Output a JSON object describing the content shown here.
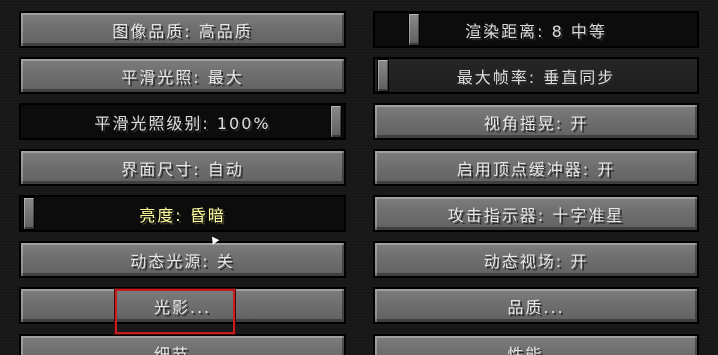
{
  "left": {
    "graphics": "图像品质: 高品质",
    "smooth_lighting": "平滑光照: 最大",
    "smooth_lighting_level": {
      "label": "平滑光照级别: 100%",
      "value": 1.0
    },
    "gui_scale": "界面尺寸: 自动",
    "brightness": {
      "label": "亮度: 昏暗",
      "value": 0.0
    },
    "dynamic_lights": "动态光源: 关",
    "shaders": "光影...",
    "details": "细节..."
  },
  "right": {
    "render_distance": {
      "label": "渲染距离: 8 中等",
      "value": 0.1
    },
    "max_framerate": {
      "label": "最大帧率: 垂直同步",
      "value": 0.0
    },
    "view_bobbing": "视角摇晃: 开",
    "use_vbos": "启用顶点缓冲器: 开",
    "attack_indicator": "攻击指示器: 十字准星",
    "dynamic_fov": "动态视场: 开",
    "quality": "品质...",
    "performance": "性能..."
  }
}
